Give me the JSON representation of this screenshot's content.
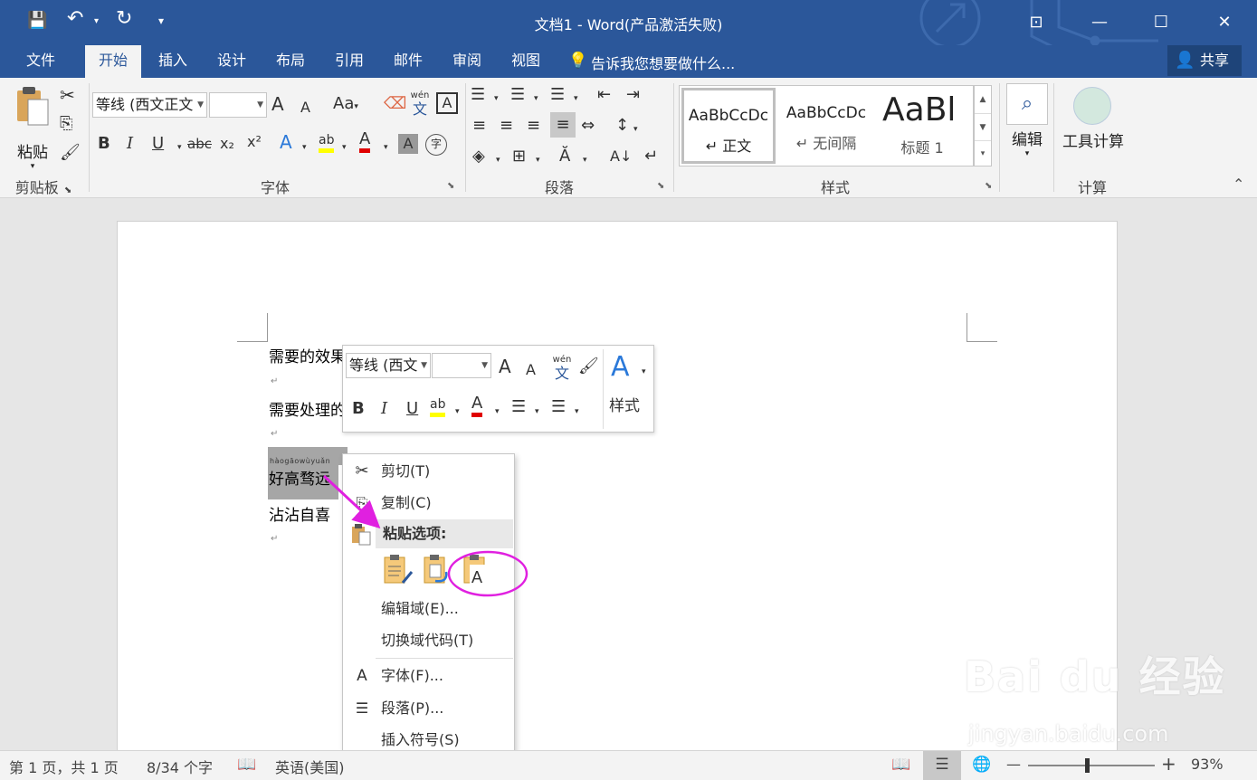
{
  "window": {
    "title": "文档1 - Word(产品激活失败)",
    "minimize": "—",
    "restore": "❐",
    "maximize": "☐",
    "close": "✕",
    "ribbon_display": "⊡"
  },
  "qat": {
    "save": "💾",
    "undo": "↶",
    "redo": "↻",
    "more": "▾"
  },
  "tabs": [
    "文件",
    "开始",
    "插入",
    "设计",
    "布局",
    "引用",
    "邮件",
    "审阅",
    "视图"
  ],
  "tell_me": "告诉我您想要做什么...",
  "share": "共享",
  "ribbon": {
    "clipboard": {
      "paste": "粘贴",
      "label": "剪贴板"
    },
    "font": {
      "name": "等线 (西文正文",
      "size": "",
      "grow": "A",
      "shrink": "A",
      "case": "Aa",
      "bold": "B",
      "italic": "I",
      "underline": "U",
      "strike": "abc",
      "sub": "x₂",
      "sup": "x²",
      "pinyin": "wén",
      "pinyin_char": "文",
      "border_char": "A",
      "shade_char": "A",
      "enclose_char": "字",
      "label": "字体"
    },
    "paragraph": {
      "label": "段落"
    },
    "styles": {
      "items": [
        {
          "sample": "AaBbCcDc",
          "name": "↵ 正文"
        },
        {
          "sample": "AaBbCcDc",
          "name": "↵ 无间隔"
        },
        {
          "sample": "AaBl",
          "name": "标题 1"
        }
      ],
      "label": "样式"
    },
    "editing": {
      "label": "编辑"
    },
    "calc": {
      "button": "工具计算",
      "label": "计算"
    }
  },
  "document": {
    "lines": [
      "需要的效果",
      "需要处理的",
      "好高骛远",
      "沾沾自喜"
    ],
    "ruby": "hàogāowùyuǎn",
    "para_mark": "↵"
  },
  "minitoolbar": {
    "font": "等线 (西文",
    "size": "",
    "grow": "A",
    "shrink": "A",
    "pinyin": "wén",
    "pinyin_char": "文",
    "bold": "B",
    "italic": "I",
    "underline": "U",
    "styles": "样式"
  },
  "context_menu": {
    "cut": "剪切(T)",
    "copy": "复制(C)",
    "paste_header": "粘贴选项:",
    "edit_field": "编辑域(E)...",
    "toggle_field": "切换域代码(T)",
    "font": "字体(F)...",
    "paragraph": "段落(P)...",
    "insert_symbol": "插入符号(S)"
  },
  "statusbar": {
    "page": "第 1 页，共 1 页",
    "words": "8/34 个字",
    "language": "英语(美国)",
    "zoom": "93%",
    "zoom_minus": "—",
    "zoom_plus": "+",
    "zoom_level": 0.93
  },
  "watermark": {
    "brand": "Bai du 经验",
    "url": "jingyan.baidu.com"
  },
  "colors": {
    "accent": "#2b579a",
    "highlight": "#ffff00",
    "font_red": "#e00000",
    "annotation": "#e020e0"
  }
}
